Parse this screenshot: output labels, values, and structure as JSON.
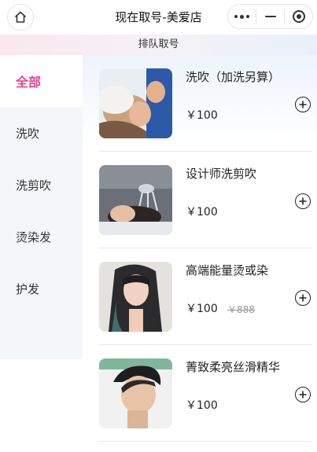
{
  "navbar": {
    "title": "现在取号-美爱店",
    "home_icon": "home-icon",
    "capsule_icons": [
      "more-icon",
      "minimize-icon",
      "close-target-icon"
    ]
  },
  "subheader": {
    "title": "排队取号"
  },
  "sidebar": {
    "items": [
      {
        "label": "全部",
        "active": true
      },
      {
        "label": "洗吹",
        "active": false
      },
      {
        "label": "洗剪吹",
        "active": false
      },
      {
        "label": "烫染发",
        "active": false
      },
      {
        "label": "护发",
        "active": false
      }
    ],
    "active_color": "#e8418c"
  },
  "products": [
    {
      "name": "洗吹（加洗另算）",
      "price": "￥100",
      "old_price": "",
      "image": "hair-wash-photo"
    },
    {
      "name": "设计师洗剪吹",
      "price": "￥100",
      "old_price": "",
      "image": "hair-rinse-photo"
    },
    {
      "name": "高端能量烫或染",
      "price": "￥100",
      "old_price": "￥888",
      "image": "long-hair-model-photo"
    },
    {
      "name": "菁致柔亮丝滑精华",
      "price": "￥100",
      "old_price": "",
      "image": "short-hair-model-photo"
    }
  ]
}
